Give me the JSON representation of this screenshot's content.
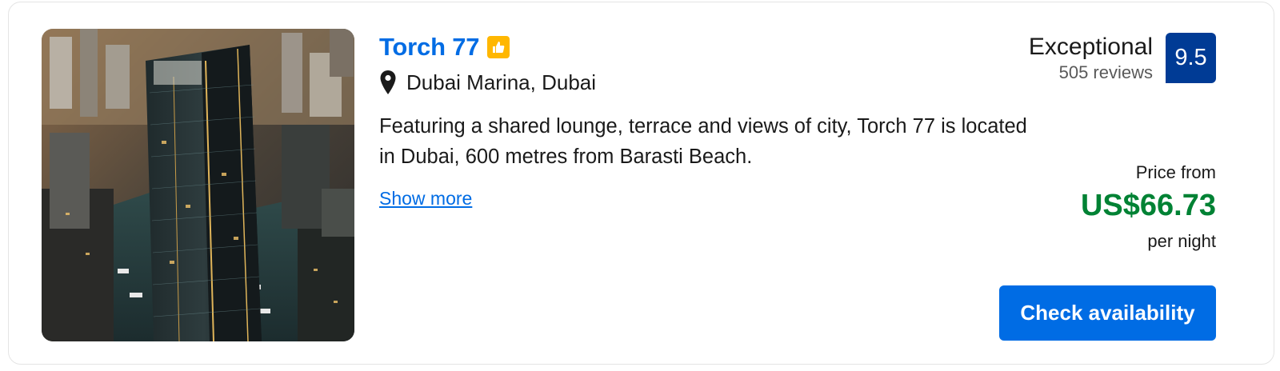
{
  "hotel": {
    "title": "Torch 77",
    "badge_icon": "thumbs-up-icon",
    "location": "Dubai Marina, Dubai",
    "description": "Featuring a shared lounge, terrace and views of city, Torch 77 is located in Dubai, 600 metres from Barasti Beach.",
    "show_more_label": "Show more"
  },
  "rating": {
    "word": "Exceptional",
    "reviews": "505 reviews",
    "score": "9.5"
  },
  "price": {
    "label": "Price from",
    "value": "US$66.73",
    "unit": "per night"
  },
  "cta": {
    "label": "Check availability"
  },
  "colors": {
    "link_blue": "#006ce4",
    "score_navy": "#003b95",
    "price_green": "#008234",
    "badge_yellow": "#ffb700"
  }
}
